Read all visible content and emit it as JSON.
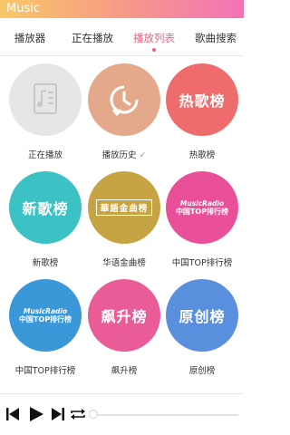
{
  "app": {
    "title": "Music"
  },
  "tabs": [
    {
      "label": "播放器",
      "active": false
    },
    {
      "label": "正在播放",
      "active": false
    },
    {
      "label": "播放列表",
      "active": true
    },
    {
      "label": "歌曲搜索",
      "active": false
    }
  ],
  "tiles": [
    {
      "label": "正在播放",
      "circle_text": "",
      "icon": "music-note-document-icon",
      "color": "#e6e6e6"
    },
    {
      "label": "播放历史",
      "circle_text": "",
      "icon": "history-clock-icon",
      "color": "#e3a98a"
    },
    {
      "label": "热歌榜",
      "circle_text": "热歌榜",
      "icon": "",
      "color": "#ee6c6c"
    },
    {
      "label": "新歌榜",
      "circle_text": "新歌榜",
      "icon": "",
      "color": "#3cc1c4"
    },
    {
      "label": "华语金曲榜",
      "circle_text": "華語金曲榜",
      "icon": "",
      "color": "#c7a443"
    },
    {
      "label": "中国TOP排行榜",
      "circle_text": "",
      "logo_top": "MusicRadio",
      "logo_bottom": "中国TOP排行榜",
      "icon": "musicradio-logo",
      "color": "#ea4f9a"
    },
    {
      "label": "中国TOP排行榜",
      "circle_text": "",
      "logo_top": "MusicRadio",
      "logo_bottom": "中国TOP排行榜",
      "icon": "musicradio-logo",
      "color": "#3a97d8"
    },
    {
      "label": "飙升榜",
      "circle_text": "飙升榜",
      "icon": "",
      "color": "#ea5c98"
    },
    {
      "label": "原创榜",
      "circle_text": "原创榜",
      "icon": "",
      "color": "#5a8fde"
    }
  ],
  "player": {
    "controls": [
      "previous-icon",
      "play-icon",
      "next-icon",
      "repeat-icon"
    ],
    "progress": 0
  },
  "colors": {
    "accent": "#f0607e",
    "title_gradient": [
      "#f9c866",
      "#f273b8"
    ]
  }
}
